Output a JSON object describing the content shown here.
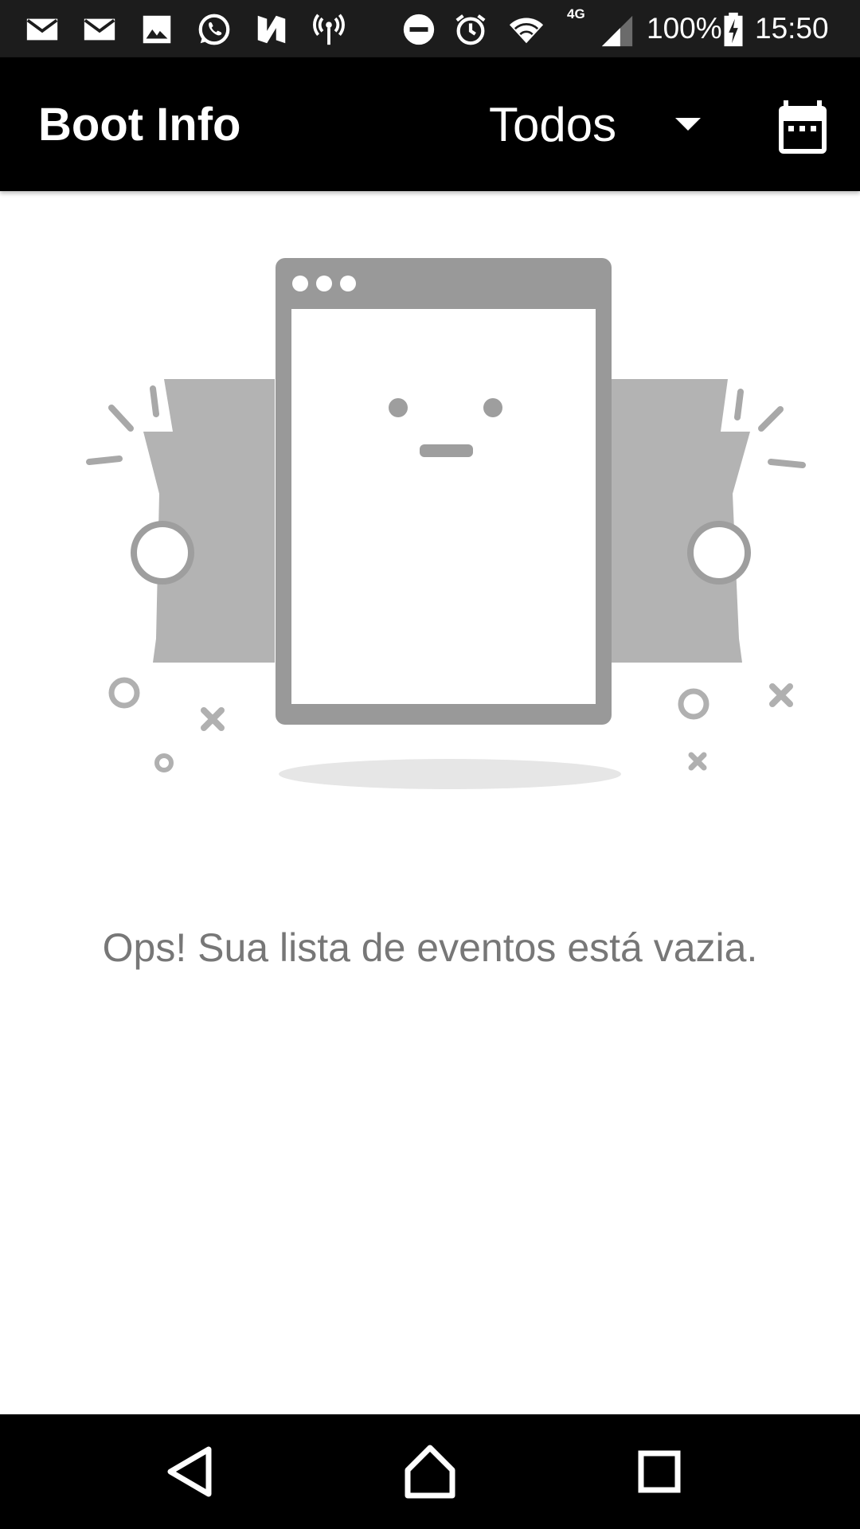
{
  "status_bar": {
    "network_type": "4G",
    "battery": "100%",
    "time": "15:50",
    "icons": [
      "mail-icon",
      "mail-icon",
      "image-icon",
      "whatsapp-icon",
      "n-app-icon",
      "hotspot-icon",
      "do-not-disturb-icon",
      "alarm-icon",
      "wifi-icon",
      "signal-icon",
      "battery-charging-icon"
    ]
  },
  "app_bar": {
    "title": "Boot Info",
    "filter": {
      "selected": "Todos"
    },
    "calendar_icon": "calendar-icon"
  },
  "empty_state": {
    "illustration": "empty-browser-illustration",
    "message": "Ops! Sua lista de eventos está vazia."
  },
  "nav_bar": {
    "icons": [
      "back-icon",
      "home-icon",
      "recents-icon"
    ]
  },
  "colors": {
    "status_bar": "#1c1c1c",
    "app_bar": "#000000",
    "background": "#ffffff",
    "illustration_dark": "#999999",
    "illustration_light": "#b3b3b3",
    "message_text": "#777777"
  }
}
